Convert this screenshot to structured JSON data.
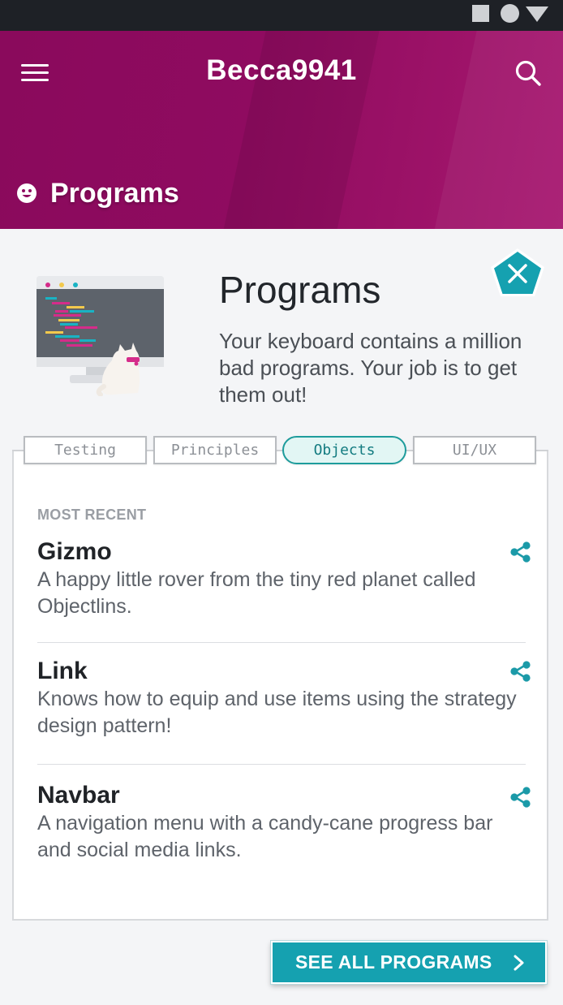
{
  "header": {
    "username": "Becca9941",
    "section_title": "Programs",
    "background_color": "#8f0b60"
  },
  "intro": {
    "title": "Programs",
    "description": "Your keyboard contains a million bad programs. Your job is to get them out!"
  },
  "tabs": [
    {
      "label": "Testing",
      "active": false
    },
    {
      "label": "Principles",
      "active": false
    },
    {
      "label": "Objects",
      "active": true
    },
    {
      "label": "UI/UX",
      "active": false
    }
  ],
  "list": {
    "section_label": "MOST RECENT",
    "items": [
      {
        "name": "Gizmo",
        "description": "A happy little rover from the  tiny red planet called Objectlins."
      },
      {
        "name": "Link",
        "description": "Knows how to equip and use items using the strategy design pattern!"
      },
      {
        "name": "Navbar",
        "description": "A navigation menu with a candy-cane progress bar and social media links."
      }
    ]
  },
  "cta": {
    "label": "SEE ALL PROGRAMS",
    "color": "#15a1b0"
  },
  "icons": [
    "menu-icon",
    "search-icon",
    "smile-icon",
    "close-icon",
    "share-icon",
    "chevron-right-icon"
  ]
}
